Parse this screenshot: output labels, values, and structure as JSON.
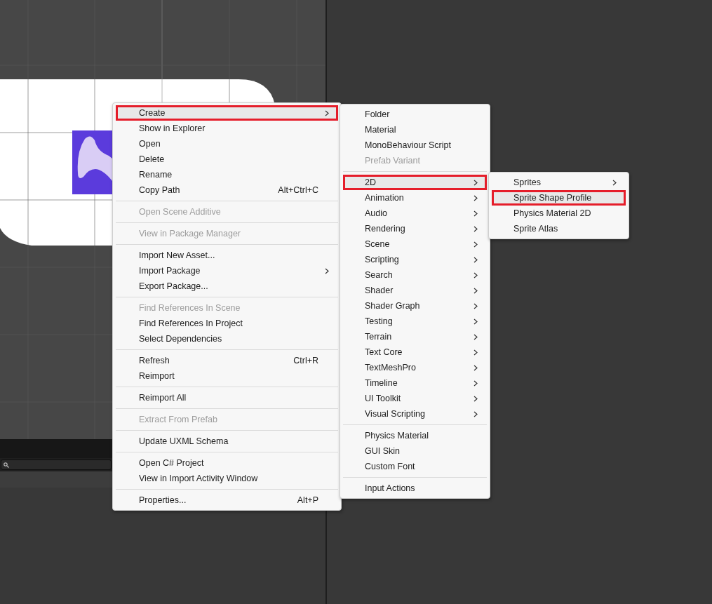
{
  "menus": [
    {
      "items": [
        {
          "kind": "item",
          "label": "Create",
          "submenu": true,
          "disabled": false,
          "selected": true,
          "highlighted": true
        },
        {
          "kind": "item",
          "label": "Show in Explorer",
          "submenu": false,
          "disabled": false,
          "selected": false,
          "highlighted": false
        },
        {
          "kind": "item",
          "label": "Open",
          "submenu": false,
          "disabled": false,
          "selected": false,
          "highlighted": false
        },
        {
          "kind": "item",
          "label": "Delete",
          "submenu": false,
          "disabled": false,
          "selected": false,
          "highlighted": false
        },
        {
          "kind": "item",
          "label": "Rename",
          "submenu": false,
          "disabled": false,
          "selected": false,
          "highlighted": false
        },
        {
          "kind": "item",
          "label": "Copy Path",
          "shortcut": "Alt+Ctrl+C",
          "submenu": false,
          "disabled": false,
          "selected": false,
          "highlighted": false
        },
        {
          "kind": "separator"
        },
        {
          "kind": "item",
          "label": "Open Scene Additive",
          "submenu": false,
          "disabled": true,
          "selected": false,
          "highlighted": false
        },
        {
          "kind": "separator"
        },
        {
          "kind": "item",
          "label": "View in Package Manager",
          "submenu": false,
          "disabled": true,
          "selected": false,
          "highlighted": false
        },
        {
          "kind": "separator"
        },
        {
          "kind": "item",
          "label": "Import New Asset...",
          "submenu": false,
          "disabled": false,
          "selected": false,
          "highlighted": false
        },
        {
          "kind": "item",
          "label": "Import Package",
          "submenu": true,
          "disabled": false,
          "selected": false,
          "highlighted": false
        },
        {
          "kind": "item",
          "label": "Export Package...",
          "submenu": false,
          "disabled": false,
          "selected": false,
          "highlighted": false
        },
        {
          "kind": "separator"
        },
        {
          "kind": "item",
          "label": "Find References In Scene",
          "submenu": false,
          "disabled": true,
          "selected": false,
          "highlighted": false
        },
        {
          "kind": "item",
          "label": "Find References In Project",
          "submenu": false,
          "disabled": false,
          "selected": false,
          "highlighted": false
        },
        {
          "kind": "item",
          "label": "Select Dependencies",
          "submenu": false,
          "disabled": false,
          "selected": false,
          "highlighted": false
        },
        {
          "kind": "separator"
        },
        {
          "kind": "item",
          "label": "Refresh",
          "shortcut": "Ctrl+R",
          "submenu": false,
          "disabled": false,
          "selected": false,
          "highlighted": false
        },
        {
          "kind": "item",
          "label": "Reimport",
          "submenu": false,
          "disabled": false,
          "selected": false,
          "highlighted": false
        },
        {
          "kind": "separator"
        },
        {
          "kind": "item",
          "label": "Reimport All",
          "submenu": false,
          "disabled": false,
          "selected": false,
          "highlighted": false
        },
        {
          "kind": "separator"
        },
        {
          "kind": "item",
          "label": "Extract From Prefab",
          "submenu": false,
          "disabled": true,
          "selected": false,
          "highlighted": false
        },
        {
          "kind": "separator"
        },
        {
          "kind": "item",
          "label": "Update UXML Schema",
          "submenu": false,
          "disabled": false,
          "selected": false,
          "highlighted": false
        },
        {
          "kind": "separator"
        },
        {
          "kind": "item",
          "label": "Open C# Project",
          "submenu": false,
          "disabled": false,
          "selected": false,
          "highlighted": false
        },
        {
          "kind": "item",
          "label": "View in Import Activity Window",
          "submenu": false,
          "disabled": false,
          "selected": false,
          "highlighted": false
        },
        {
          "kind": "separator"
        },
        {
          "kind": "item",
          "label": "Properties...",
          "shortcut": "Alt+P",
          "submenu": false,
          "disabled": false,
          "selected": false,
          "highlighted": false
        }
      ]
    },
    {
      "items": [
        {
          "kind": "item",
          "label": "Folder",
          "submenu": false,
          "disabled": false,
          "selected": false,
          "highlighted": false
        },
        {
          "kind": "item",
          "label": "Material",
          "submenu": false,
          "disabled": false,
          "selected": false,
          "highlighted": false
        },
        {
          "kind": "item",
          "label": "MonoBehaviour Script",
          "submenu": false,
          "disabled": false,
          "selected": false,
          "highlighted": false
        },
        {
          "kind": "item",
          "label": "Prefab Variant",
          "submenu": false,
          "disabled": true,
          "selected": false,
          "highlighted": false
        },
        {
          "kind": "separator"
        },
        {
          "kind": "item",
          "label": "2D",
          "submenu": true,
          "disabled": false,
          "selected": true,
          "highlighted": true
        },
        {
          "kind": "item",
          "label": "Animation",
          "submenu": true,
          "disabled": false,
          "selected": false,
          "highlighted": false
        },
        {
          "kind": "item",
          "label": "Audio",
          "submenu": true,
          "disabled": false,
          "selected": false,
          "highlighted": false
        },
        {
          "kind": "item",
          "label": "Rendering",
          "submenu": true,
          "disabled": false,
          "selected": false,
          "highlighted": false
        },
        {
          "kind": "item",
          "label": "Scene",
          "submenu": true,
          "disabled": false,
          "selected": false,
          "highlighted": false
        },
        {
          "kind": "item",
          "label": "Scripting",
          "submenu": true,
          "disabled": false,
          "selected": false,
          "highlighted": false
        },
        {
          "kind": "item",
          "label": "Search",
          "submenu": true,
          "disabled": false,
          "selected": false,
          "highlighted": false
        },
        {
          "kind": "item",
          "label": "Shader",
          "submenu": true,
          "disabled": false,
          "selected": false,
          "highlighted": false
        },
        {
          "kind": "item",
          "label": "Shader Graph",
          "submenu": true,
          "disabled": false,
          "selected": false,
          "highlighted": false
        },
        {
          "kind": "item",
          "label": "Testing",
          "submenu": true,
          "disabled": false,
          "selected": false,
          "highlighted": false
        },
        {
          "kind": "item",
          "label": "Terrain",
          "submenu": true,
          "disabled": false,
          "selected": false,
          "highlighted": false
        },
        {
          "kind": "item",
          "label": "Text Core",
          "submenu": true,
          "disabled": false,
          "selected": false,
          "highlighted": false
        },
        {
          "kind": "item",
          "label": "TextMeshPro",
          "submenu": true,
          "disabled": false,
          "selected": false,
          "highlighted": false
        },
        {
          "kind": "item",
          "label": "Timeline",
          "submenu": true,
          "disabled": false,
          "selected": false,
          "highlighted": false
        },
        {
          "kind": "item",
          "label": "UI Toolkit",
          "submenu": true,
          "disabled": false,
          "selected": false,
          "highlighted": false
        },
        {
          "kind": "item",
          "label": "Visual Scripting",
          "submenu": true,
          "disabled": false,
          "selected": false,
          "highlighted": false
        },
        {
          "kind": "separator"
        },
        {
          "kind": "item",
          "label": "Physics Material",
          "submenu": false,
          "disabled": false,
          "selected": false,
          "highlighted": false
        },
        {
          "kind": "item",
          "label": "GUI Skin",
          "submenu": false,
          "disabled": false,
          "selected": false,
          "highlighted": false
        },
        {
          "kind": "item",
          "label": "Custom Font",
          "submenu": false,
          "disabled": false,
          "selected": false,
          "highlighted": false
        },
        {
          "kind": "separator"
        },
        {
          "kind": "item",
          "label": "Input Actions",
          "submenu": false,
          "disabled": false,
          "selected": false,
          "highlighted": false
        }
      ]
    },
    {
      "items": [
        {
          "kind": "item",
          "label": "Sprites",
          "submenu": true,
          "disabled": false,
          "selected": false,
          "highlighted": false
        },
        {
          "kind": "item",
          "label": "Sprite Shape Profile",
          "submenu": false,
          "disabled": false,
          "selected": true,
          "highlighted": true
        },
        {
          "kind": "item",
          "label": "Physics Material 2D",
          "submenu": false,
          "disabled": false,
          "selected": false,
          "highlighted": false
        },
        {
          "kind": "item",
          "label": "Sprite Atlas",
          "submenu": false,
          "disabled": false,
          "selected": false,
          "highlighted": false
        }
      ]
    }
  ]
}
